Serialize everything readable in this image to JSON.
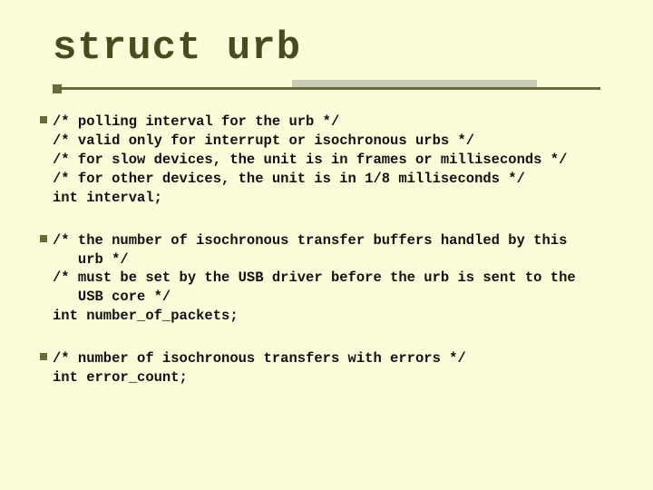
{
  "title": "struct urb",
  "blocks": [
    {
      "lines": [
        {
          "text": "/* polling interval for the urb */",
          "indent": false
        },
        {
          "text": "/* valid only for interrupt or isochronous urbs */",
          "indent": false
        },
        {
          "text": "/* for slow devices, the unit is in frames or milliseconds */",
          "indent": false
        },
        {
          "text": "/* for other devices, the unit is in 1/8 milliseconds */",
          "indent": false
        },
        {
          "text": "int interval;",
          "indent": false
        }
      ]
    },
    {
      "lines": [
        {
          "text": "/* the number of isochronous transfer buffers handled by this",
          "indent": false
        },
        {
          "text": "urb */",
          "indent": true
        },
        {
          "text": "/* must be set by the USB driver before the urb is sent to the",
          "indent": false
        },
        {
          "text": "USB core */",
          "indent": true
        },
        {
          "text": "int number_of_packets;",
          "indent": false
        }
      ]
    },
    {
      "lines": [
        {
          "text": "/* number of isochronous transfers with errors */",
          "indent": false
        },
        {
          "text": "int error_count;",
          "indent": false
        }
      ]
    }
  ]
}
